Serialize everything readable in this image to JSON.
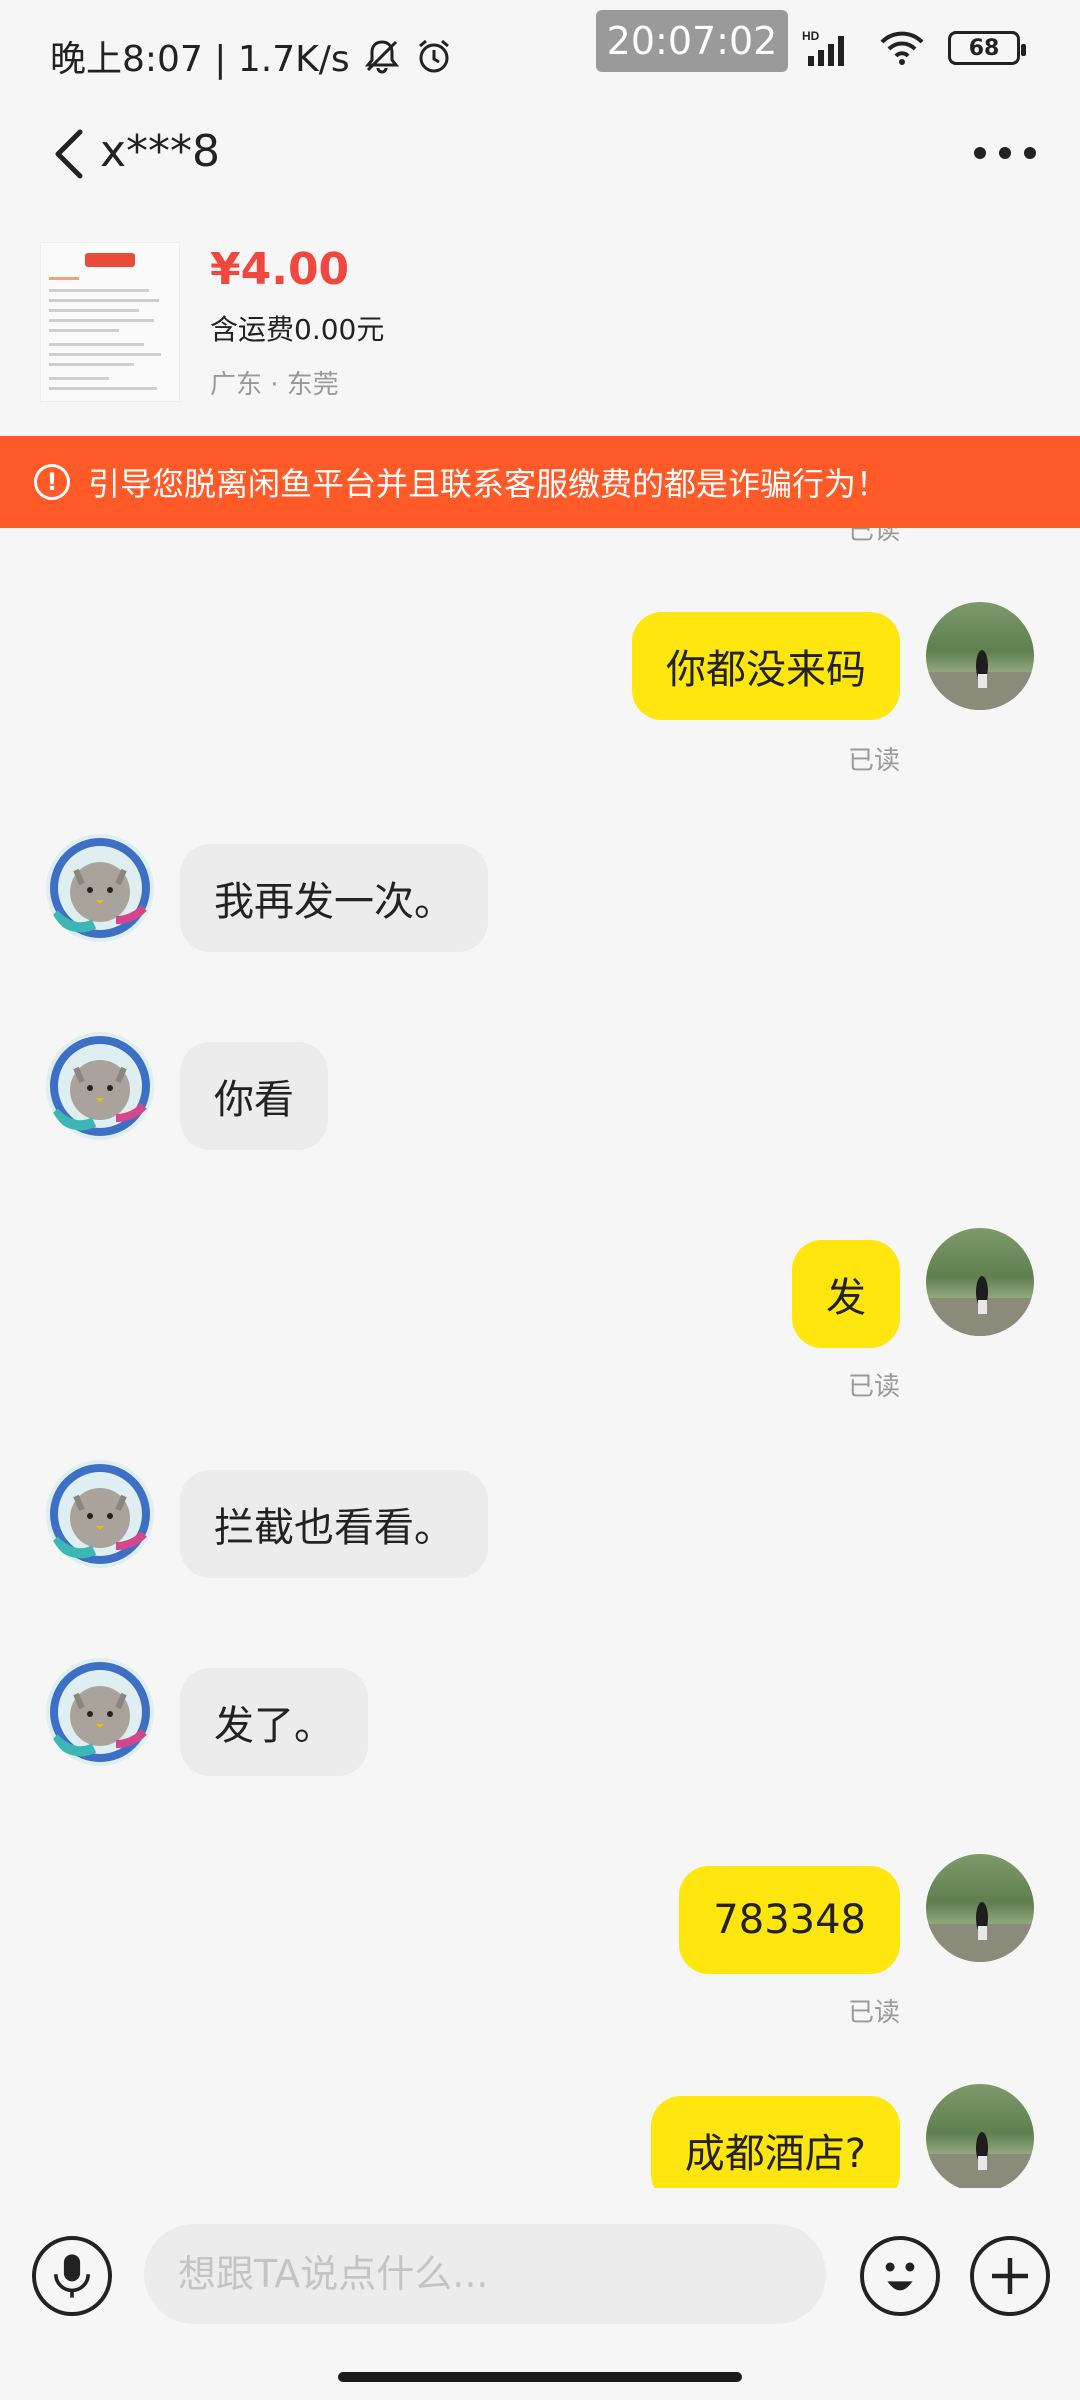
{
  "status_bar": {
    "left_text": "晚上8:07 | 1.7K/s",
    "time_overlay": "20:07:02",
    "network": "HD",
    "battery": "68",
    "icons": [
      "bell-off-icon",
      "alarm-icon",
      "signal-icon",
      "wifi-icon",
      "battery-icon"
    ]
  },
  "header": {
    "title": "x***8"
  },
  "product": {
    "price": "¥4.00",
    "shipping": "含运费0.00元",
    "location": "广东 · 东莞"
  },
  "warning": {
    "text": "引导您脱离闲鱼平台并且联系客服缴费的都是诈骗行为！"
  },
  "messages": [
    {
      "side": "me",
      "text": "你都没来码",
      "status": "已读"
    },
    {
      "side": "them",
      "text": "我再发一次。"
    },
    {
      "side": "them",
      "text": "你看"
    },
    {
      "side": "me",
      "text": "发",
      "status": "已读"
    },
    {
      "side": "them",
      "text": "拦截也看看。"
    },
    {
      "side": "them",
      "text": "发了。"
    },
    {
      "side": "me",
      "text": "783348",
      "status": "已读"
    },
    {
      "side": "me",
      "text": "成都酒店?"
    }
  ],
  "input": {
    "placeholder": "想跟TA说点什么..."
  },
  "colors": {
    "accent_yellow": "#ffe60f",
    "warning_orange": "#ff5a28",
    "price_red": "#f0483e"
  }
}
